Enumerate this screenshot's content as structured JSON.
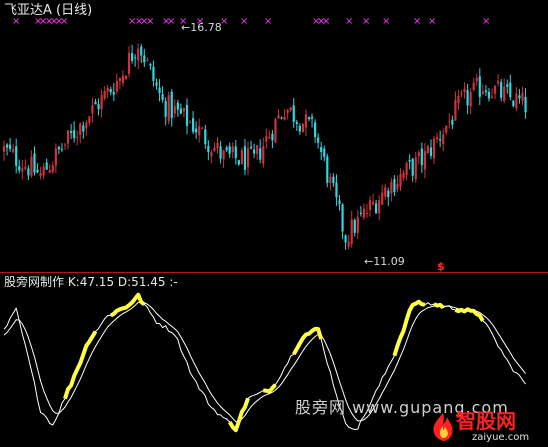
{
  "header": {
    "title": "飞亚达A (日线)"
  },
  "price_panel": {
    "high_label": "16.78",
    "low_label": "←11.09",
    "signal_symbol": "$"
  },
  "indicator_panel": {
    "title": "股旁网制作  K:47.15  D:51.45  :-"
  },
  "watermark": {
    "text": "股旁网  www.gupang.com"
  },
  "brand": {
    "name": "智股网",
    "url": "zaiyue.com"
  },
  "colors": {
    "background": "#000000",
    "up_candle": "#d0313d",
    "down_candle": "#2fd7de",
    "marker": "#ff35ff",
    "k_line": "#ffffff",
    "d_line": "#ffffff",
    "highlight": "#ffff44",
    "divider": "#b0191c",
    "brand_red": "#ff2020"
  },
  "chart_data": [
    {
      "type": "candlestick",
      "title": "飞亚达A (日线)",
      "annotations": [
        {
          "label": "16.78",
          "value": 16.78
        },
        {
          "label": "11.09",
          "value": 11.09
        }
      ],
      "ylim": [
        10.5,
        17.2
      ],
      "anchors": [
        [
          0,
          13.6
        ],
        [
          12,
          12.9
        ],
        [
          26,
          14.4
        ],
        [
          38,
          15.6
        ],
        [
          44,
          16.6
        ],
        [
          52,
          14.9
        ],
        [
          62,
          14.3
        ],
        [
          72,
          13.4
        ],
        [
          82,
          13.3
        ],
        [
          92,
          14.8
        ],
        [
          102,
          14.1
        ],
        [
          112,
          11.2
        ],
        [
          126,
          12.6
        ],
        [
          138,
          13.4
        ],
        [
          150,
          14.9
        ],
        [
          157,
          15.4
        ],
        [
          172,
          14.8
        ]
      ],
      "count": 172
    },
    {
      "type": "line",
      "title": "股旁网制作",
      "series": [
        {
          "name": "K",
          "last": 47.15
        },
        {
          "name": "D",
          "last": 51.45
        }
      ],
      "ylim": [
        0,
        100
      ],
      "k_anchors": [
        [
          0,
          74
        ],
        [
          4,
          88
        ],
        [
          8,
          55
        ],
        [
          12,
          20
        ],
        [
          16,
          10
        ],
        [
          22,
          38
        ],
        [
          28,
          68
        ],
        [
          34,
          84
        ],
        [
          40,
          90
        ],
        [
          44,
          97
        ],
        [
          50,
          80
        ],
        [
          56,
          72
        ],
        [
          62,
          42
        ],
        [
          68,
          22
        ],
        [
          76,
          8
        ],
        [
          80,
          28
        ],
        [
          88,
          35
        ],
        [
          98,
          70
        ],
        [
          103,
          75
        ],
        [
          108,
          38
        ],
        [
          112,
          10
        ],
        [
          116,
          8
        ],
        [
          120,
          24
        ],
        [
          128,
          58
        ],
        [
          134,
          92
        ],
        [
          140,
          92
        ],
        [
          150,
          88
        ],
        [
          156,
          85
        ],
        [
          166,
          50
        ],
        [
          171,
          38
        ]
      ],
      "highlight_segments": [
        [
          20,
          30
        ],
        [
          35,
          46
        ],
        [
          74,
          80
        ],
        [
          85,
          89
        ],
        [
          95,
          104
        ],
        [
          128,
          138
        ],
        [
          141,
          144
        ],
        [
          148,
          157
        ]
      ]
    }
  ]
}
